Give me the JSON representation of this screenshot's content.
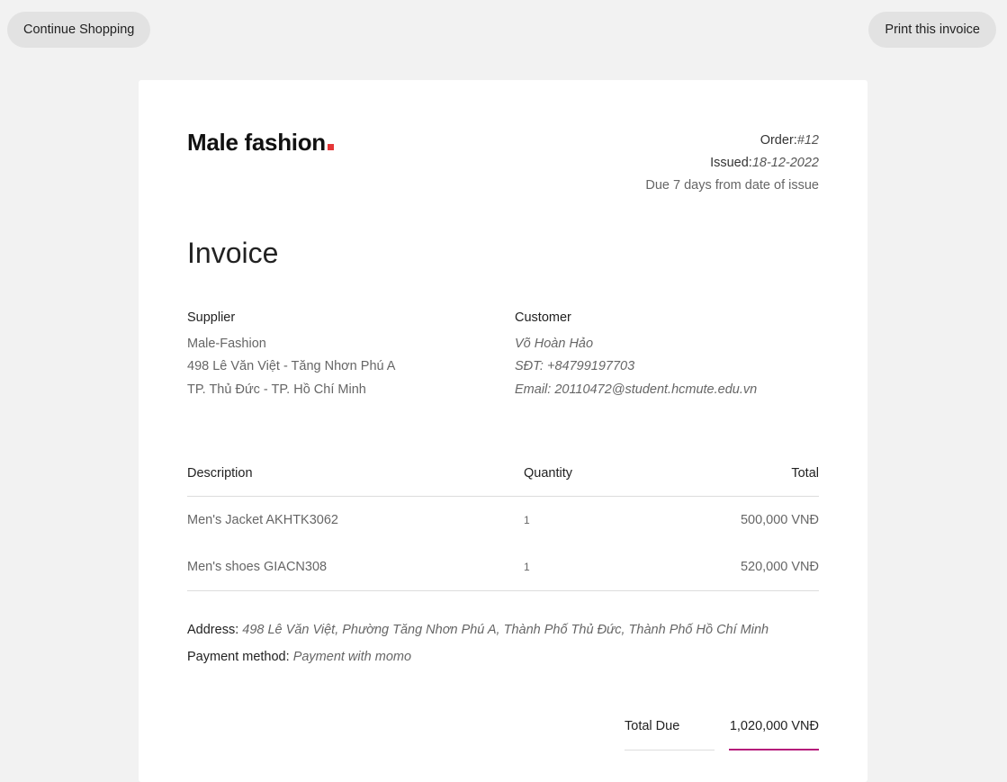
{
  "top_bar": {
    "continue_label": "Continue Shopping",
    "print_label": "Print this invoice"
  },
  "brand": {
    "name": "Male fashion",
    "accent_color": "#e53637"
  },
  "meta": {
    "order_label": "Order:",
    "order_value": "#12",
    "issued_label": "Issued:",
    "issued_value": "18-12-2022",
    "due_text": "Due 7 days from date of issue"
  },
  "title": "Invoice",
  "supplier": {
    "heading": "Supplier",
    "lines": [
      "Male-Fashion",
      "498 Lê Văn Việt - Tăng Nhơn Phú A",
      "TP. Thủ Đức - TP. Hồ Chí Minh"
    ]
  },
  "customer": {
    "heading": "Customer",
    "lines": [
      "Võ Hoàn Hảo",
      "SĐT: +84799197703",
      "Email: 20110472@student.hcmute.edu.vn"
    ]
  },
  "items": {
    "headers": [
      "Description",
      "Quantity",
      "Total"
    ],
    "rows": [
      {
        "description": "Men's Jacket AKHTK3062",
        "quantity": "1",
        "total": "500,000 VNĐ"
      },
      {
        "description": "Men's shoes GIACN308",
        "quantity": "1",
        "total": "520,000 VNĐ"
      }
    ]
  },
  "details": {
    "address_label": "Address:",
    "address_value": "498 Lê Văn Việt, Phường Tăng Nhơn Phú A, Thành Phố Thủ Đức, Thành Phố Hồ Chí Minh",
    "payment_label": "Payment method:",
    "payment_value": "Payment with momo"
  },
  "total_due": {
    "label": "Total Due",
    "amount": "1,020,000 VNĐ",
    "underline_color": "#b5197a"
  }
}
